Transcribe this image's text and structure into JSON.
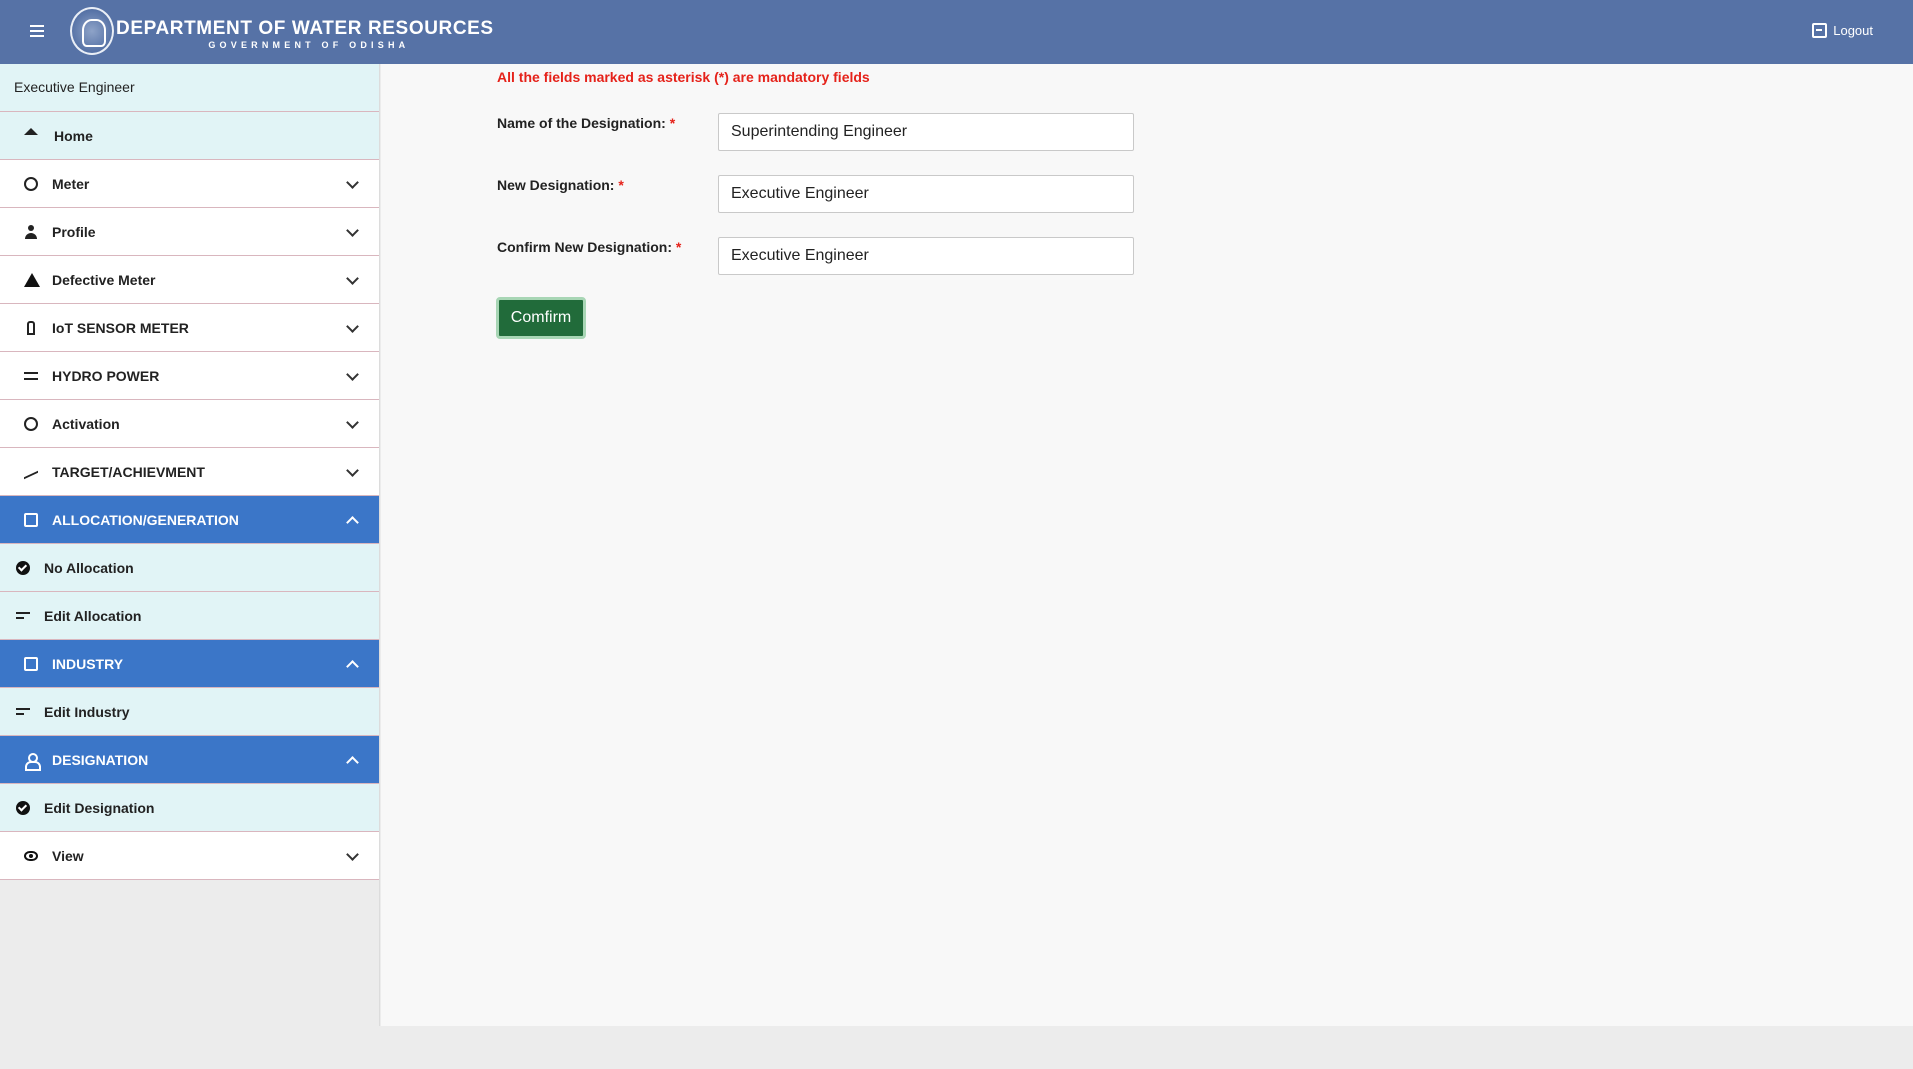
{
  "header": {
    "title": "DEPARTMENT OF WATER RESOURCES",
    "subtitle": "GOVERNMENT OF ODISHA",
    "logout_label": "Logout",
    "bg_color": "#5672a6"
  },
  "sidebar": {
    "role": "Executive Engineer",
    "items": [
      {
        "label": "Home",
        "icon": "home-icon"
      },
      {
        "label": "Meter",
        "icon": "meter-icon"
      },
      {
        "label": "Profile",
        "icon": "person-icon"
      },
      {
        "label": "Defective Meter",
        "icon": "warning-icon"
      },
      {
        "label": "IoT SENSOR METER",
        "icon": "sensor-icon"
      },
      {
        "label": "HYDRO POWER",
        "icon": "waves-icon"
      },
      {
        "label": "Activation",
        "icon": "refresh-icon"
      },
      {
        "label": "TARGET/ACHIEVMENT",
        "icon": "trending-icon"
      },
      {
        "label": "ALLOCATION/GENERATION",
        "icon": "allocation-icon"
      },
      {
        "label": "No Allocation",
        "icon": "check-circle-icon"
      },
      {
        "label": "Edit Allocation",
        "icon": "edit-note-icon"
      },
      {
        "label": "INDUSTRY",
        "icon": "building-icon"
      },
      {
        "label": "Edit Industry",
        "icon": "edit-note-icon"
      },
      {
        "label": "DESIGNATION",
        "icon": "person-outline-icon"
      },
      {
        "label": "Edit Designation",
        "icon": "check-circle-icon"
      },
      {
        "label": "View",
        "icon": "eye-icon"
      }
    ],
    "active_color": "#3b76c8"
  },
  "form": {
    "mandatory_note": "All the fields marked as asterisk (*) are mandatory fields",
    "star": "*",
    "fields": [
      {
        "label": "Name of the Designation:",
        "value": "Superintending Engineer"
      },
      {
        "label": "New Designation:",
        "value": "Executive Engineer"
      },
      {
        "label": "Confirm New Designation:",
        "value": "Executive Engineer"
      }
    ],
    "confirm_label": "Comfirm",
    "confirm_color": "#216b3a"
  }
}
